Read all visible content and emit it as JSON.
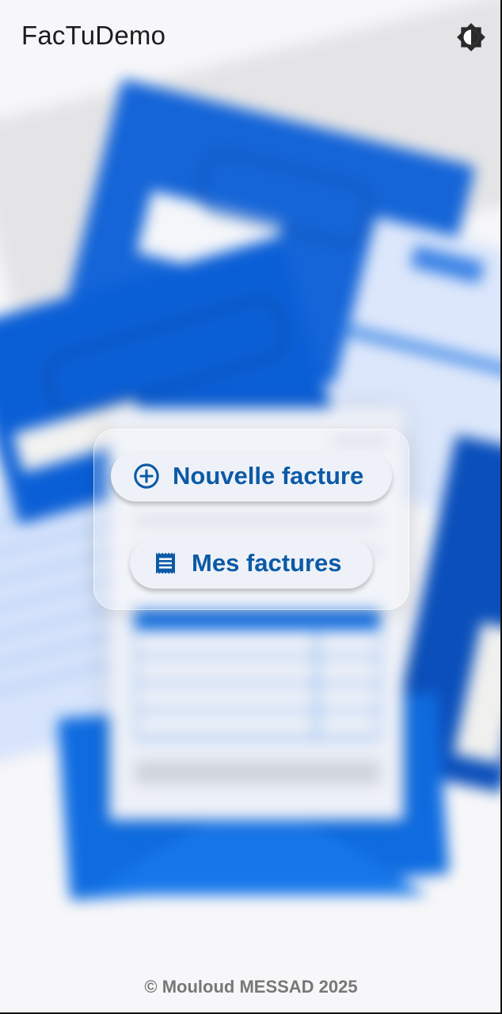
{
  "app_bar": {
    "title": "FacTuDemo",
    "theme_toggle_icon": "brightness-contrast-icon"
  },
  "actions": {
    "new_invoice": {
      "label": "Nouvelle facture",
      "icon": "add-circle-icon"
    },
    "my_invoices": {
      "label": "Mes factures",
      "icon": "receipt-icon"
    }
  },
  "footer": {
    "copyright": "© Mouloud MESSAD 2025"
  },
  "colors": {
    "accent": "#0c5aa6",
    "illustration_blue": "#0f6ce0",
    "button_background": "#eef2f8",
    "footer_text": "#777777"
  }
}
